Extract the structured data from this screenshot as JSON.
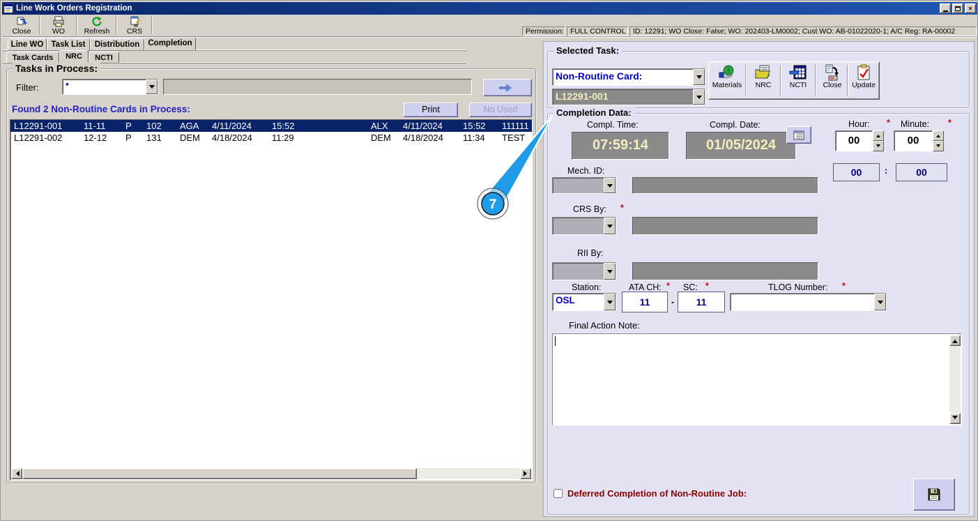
{
  "window": {
    "title": "Line Work Orders Registration",
    "controls": {
      "close_glyph": "×"
    }
  },
  "toolbar": {
    "buttons": [
      {
        "label": "Close"
      },
      {
        "label": "WO"
      },
      {
        "label": "Refresh"
      },
      {
        "label": "CRS"
      }
    ]
  },
  "permission": {
    "label": "Permission:",
    "level": "FULL CONTROL",
    "details": "ID: 12291; WO Close: False; WO: 202403-LM0002; Cust WO: AB-01022020-1; A/C Reg: RA-00002"
  },
  "tabs": {
    "main": [
      "Line WO",
      "Task List",
      "Distribution",
      "Completion"
    ],
    "active_main": "Completion",
    "sub": [
      "Task Cards",
      "NRC",
      "NCTI"
    ],
    "active_sub": "NRC"
  },
  "tasks_panel": {
    "title": "Tasks in Process:",
    "filter_label": "Filter:",
    "filter_value": "*",
    "search_value": "",
    "found_text": "Found 2 Non-Routine Cards in Process:",
    "print_button": "Print",
    "no_used_button": "No Used",
    "rows": [
      {
        "selected": true,
        "cols": [
          "L12291-001",
          "11-11",
          "P",
          "102",
          "AGA",
          "4/11/2024",
          "15:52",
          "ALX",
          "4/11/2024",
          "15:52",
          "111111"
        ]
      },
      {
        "selected": false,
        "cols": [
          "L12291-002",
          "12-12",
          "P",
          "131",
          "DEM",
          "4/18/2024",
          "11:29",
          "DEM",
          "4/18/2024",
          "11:34",
          "TEST"
        ]
      }
    ]
  },
  "selected_task": {
    "title": "Selected Task:",
    "type_value": "Non-Routine Card:",
    "card_value": "L12291-001",
    "actions": [
      {
        "label": "Materials"
      },
      {
        "label": "NRC"
      },
      {
        "label": "NCTI"
      },
      {
        "label": "Close"
      },
      {
        "label": "Update"
      }
    ]
  },
  "completion": {
    "title": "Completion Data:",
    "compl_time_label": "Compl. Time:",
    "compl_time": "07:59:14",
    "compl_date_label": "Compl. Date:",
    "compl_date": "01/05/2024",
    "hour_label": "Hour:",
    "hour_value": "00",
    "minute_label": "Minute:",
    "minute_value": "00",
    "hour_display": "00",
    "time_separator": ":",
    "minute_display": "00",
    "mech_id_label": "Mech. ID:",
    "crs_by_label": "CRS By:",
    "rii_by_label": "RII By:",
    "station_label": "Station:",
    "station_value": "OSL",
    "ata_ch_label": "ATA CH:",
    "ata_ch_value": "11",
    "ata_separator": "-",
    "sc_label": "SC:",
    "sc_value": "11",
    "tlog_label": "TLOG Number:",
    "final_note_label": "Final Action Note:",
    "final_note_value": "",
    "deferred_label": "Deferred Completion of Non-Routine Job:",
    "required_marker": "*"
  },
  "annotation": {
    "number": "7"
  },
  "colors": {
    "titlebar": "#0A246A",
    "window_bg": "#D6D2CA",
    "panel_bg": "#E2E2F2",
    "accent_button": "#CFCFF0",
    "field_gray": "#8A8A8A",
    "field_value_yellow": "#F2EFBE",
    "selection_navy": "#0A246A",
    "link_blue": "#2020C8",
    "required_red": "#CC0000",
    "deferred_dark_red": "#8B0000",
    "callout_blue": "#1E9BE9"
  }
}
